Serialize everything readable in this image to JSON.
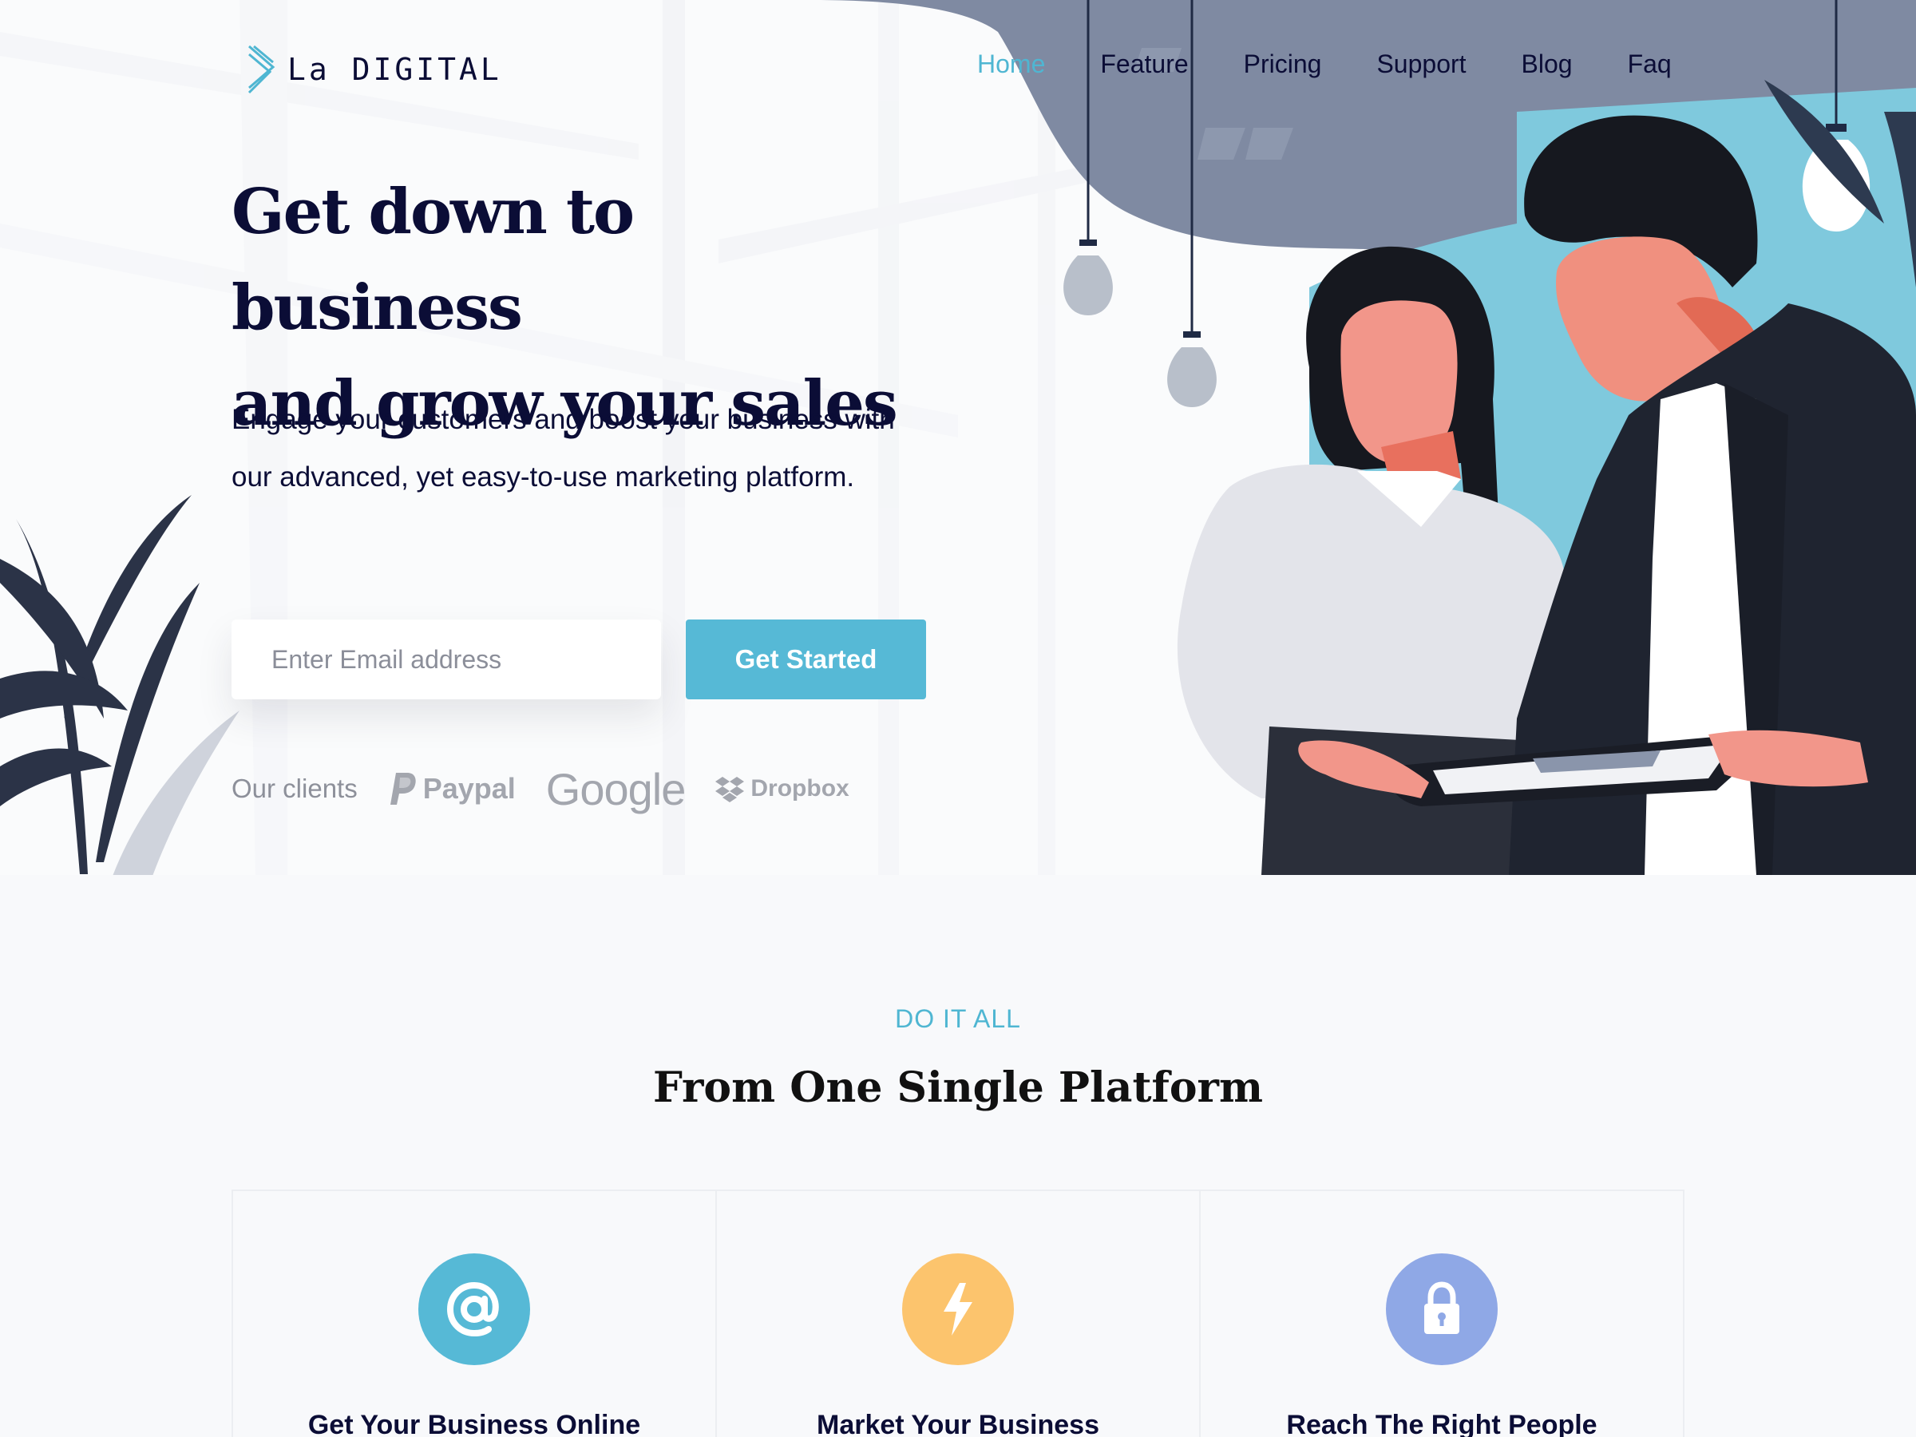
{
  "brand": {
    "name": "La DIGITAL",
    "accent": "#4fb6d2",
    "dark": "#0b0d36"
  },
  "nav": {
    "items": [
      {
        "label": "Home",
        "active": true
      },
      {
        "label": "Feature",
        "active": false
      },
      {
        "label": "Pricing",
        "active": false
      },
      {
        "label": "Support",
        "active": false
      },
      {
        "label": "Blog",
        "active": false
      },
      {
        "label": "Faq",
        "active": false
      }
    ]
  },
  "hero": {
    "headline_line1": "Get down to business",
    "headline_line2": "and grow your sales",
    "subtext": "Engage your customers and boost your business with our advanced, yet easy-to-use marketing platform.",
    "email_placeholder": "Enter Email address",
    "email_value": "",
    "cta_label": "Get Started",
    "cta_color": "#56b9d6"
  },
  "clients": {
    "label": "Our clients",
    "logos": [
      {
        "name": "Paypal",
        "icon": "paypal-icon"
      },
      {
        "name": "Google",
        "icon": "google-wordmark"
      },
      {
        "name": "Dropbox",
        "icon": "dropbox-icon"
      }
    ]
  },
  "features": {
    "eyebrow": "DO IT ALL",
    "title": "From One Single Platform",
    "cards": [
      {
        "title": "Get Your Business Online",
        "icon": "at-sign-icon",
        "color": "#56b9d6"
      },
      {
        "title": "Market Your Business",
        "icon": "lightning-bolt-icon",
        "color": "#fcc46d"
      },
      {
        "title": "Reach The Right People",
        "icon": "lock-icon",
        "color": "#8fa8e6"
      }
    ]
  }
}
